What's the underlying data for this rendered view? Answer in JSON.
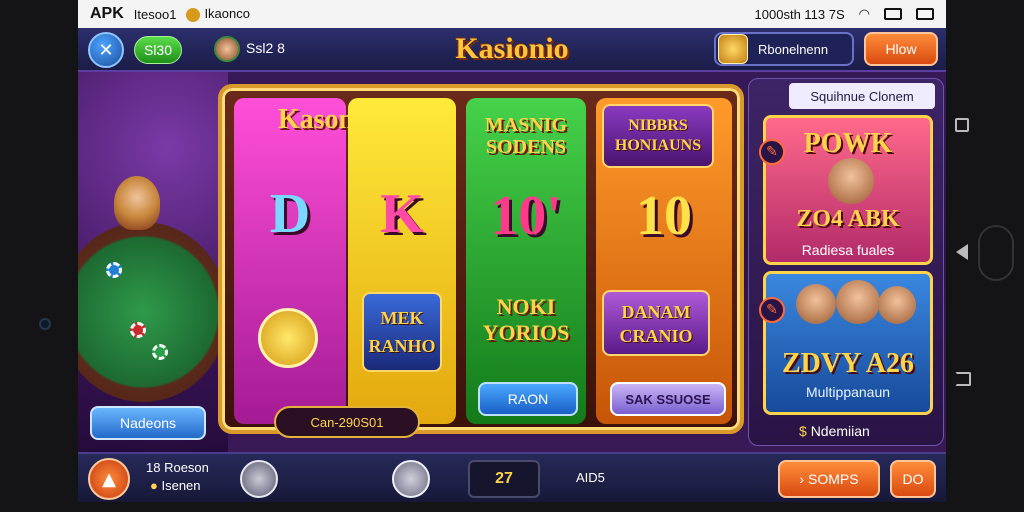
{
  "statusbar": {
    "apk": "APK",
    "left_text": "Itesoo1",
    "app_name": "Ikaonco",
    "right_text": "1000sth 113 7S"
  },
  "topbar": {
    "left_badge": "Sl30",
    "player_count": "Ssl2 8",
    "logo": "Kasionio",
    "coin_label": "Rbonelnenn",
    "orange_button": "Hlow"
  },
  "slot": {
    "reel1_title": "Kasono",
    "reel1_symbol": "D",
    "reel2_symbol": "K",
    "reel2_badge": "MEK RANHO",
    "reel3_title": "MASNIG SODENS",
    "reel3_symbol": "10'",
    "reel3_badge": "NOKI YORIOS",
    "reel3_button": "RAON",
    "reel4_title": "NIBBRS HONIAUNS",
    "reel4_symbol": "10",
    "reel4_badge": "DANAM CRANIO",
    "reel4_button": "SAK SSUOSE",
    "center_pill": "Can-290S01"
  },
  "left": {
    "blue_button": "Nadeons"
  },
  "right_panel": {
    "header": "Squihnue Clonem",
    "card1_title": "POWK",
    "card1_big": "ZO4 ABK",
    "card1_sub": "Radiesa fuales",
    "card2_big": "ZDVY A26",
    "card2_sub": "Multippanaun",
    "footer": "Ndemiian"
  },
  "bottombar": {
    "text_line1": "18 Roeson",
    "text_line2": "Isenen",
    "counter": "27",
    "aid_label": "AID5",
    "orange_button": "SOMPS",
    "orange_button2": "DO"
  }
}
